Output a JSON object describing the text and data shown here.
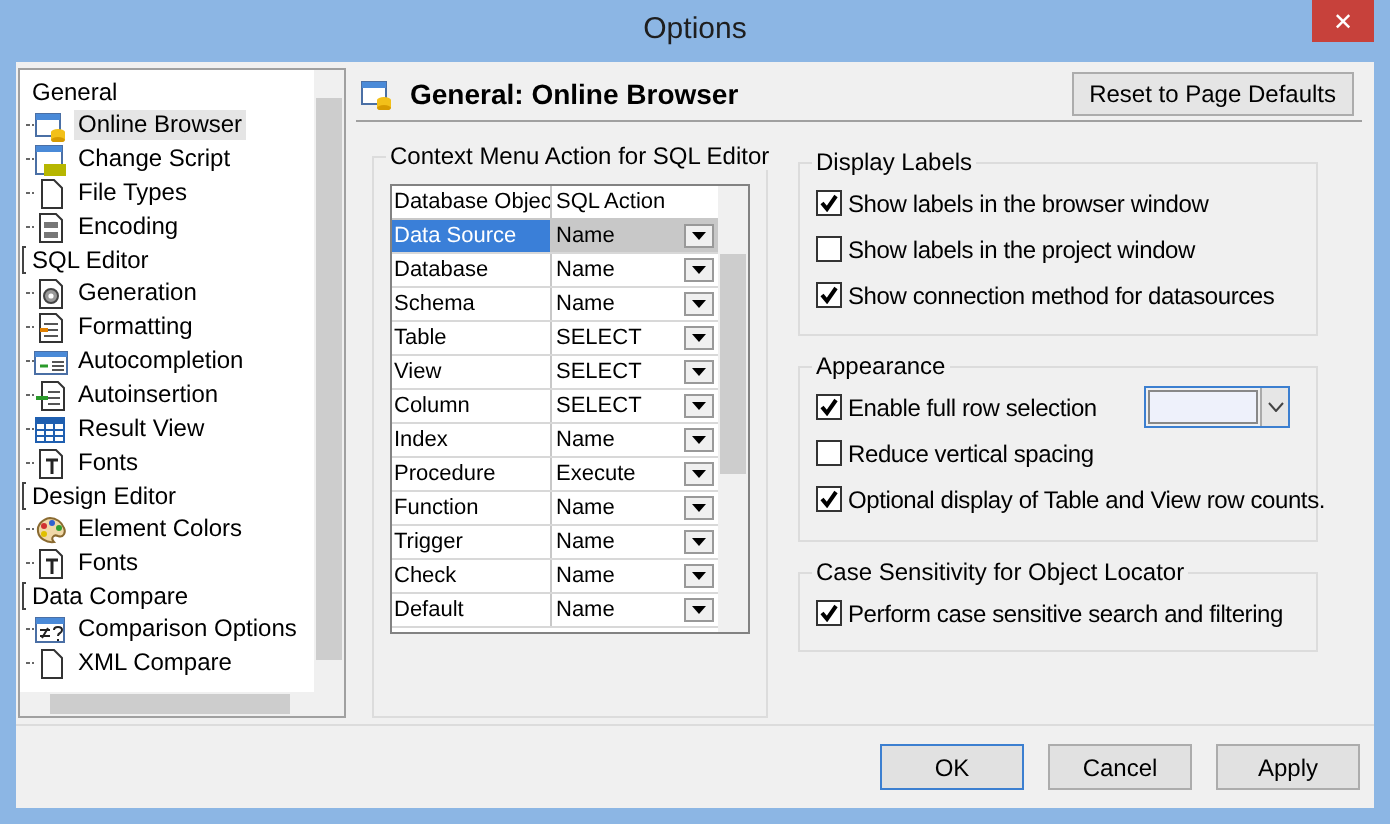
{
  "window": {
    "title": "Options",
    "close": "✕"
  },
  "sidebar": {
    "groups": [
      {
        "label": "General",
        "items": [
          {
            "label": "Online Browser",
            "kind": "browser",
            "selected": true
          },
          {
            "label": "Change Script",
            "kind": "sql",
            "selected": false
          },
          {
            "label": "File Types",
            "kind": "file",
            "selected": false
          },
          {
            "label": "Encoding",
            "kind": "encoding",
            "selected": false
          }
        ]
      },
      {
        "label": "SQL Editor",
        "items": [
          {
            "label": "Generation",
            "kind": "gear",
            "selected": false
          },
          {
            "label": "Formatting",
            "kind": "format",
            "selected": false
          },
          {
            "label": "Autocompletion",
            "kind": "list",
            "selected": false
          },
          {
            "label": "Autoinsertion",
            "kind": "insert",
            "selected": false
          },
          {
            "label": "Result View",
            "kind": "grid",
            "selected": false
          },
          {
            "label": "Fonts",
            "kind": "font",
            "selected": false
          }
        ]
      },
      {
        "label": "Design Editor",
        "items": [
          {
            "label": "Element Colors",
            "kind": "palette",
            "selected": false
          },
          {
            "label": "Fonts",
            "kind": "font",
            "selected": false
          }
        ]
      },
      {
        "label": "Data Compare",
        "items": [
          {
            "label": "Comparison Options",
            "kind": "compare",
            "selected": false
          },
          {
            "label": "XML Compare",
            "kind": "file",
            "selected": false
          }
        ]
      }
    ]
  },
  "page": {
    "title": "General: Online Browser",
    "reset_button": "Reset to Page Defaults"
  },
  "context_menu": {
    "title": "Context Menu Action for SQL Editor",
    "columns": [
      "Database Objec",
      "SQL Action"
    ],
    "rows": [
      {
        "object": "Data Source",
        "action": "Name",
        "selected": true
      },
      {
        "object": "Database",
        "action": "Name",
        "selected": false
      },
      {
        "object": "Schema",
        "action": "Name",
        "selected": false
      },
      {
        "object": "Table",
        "action": "SELECT",
        "selected": false
      },
      {
        "object": "View",
        "action": "SELECT",
        "selected": false
      },
      {
        "object": "Column",
        "action": "SELECT",
        "selected": false
      },
      {
        "object": "Index",
        "action": "Name",
        "selected": false
      },
      {
        "object": "Procedure",
        "action": "Execute",
        "selected": false
      },
      {
        "object": "Function",
        "action": "Name",
        "selected": false
      },
      {
        "object": "Trigger",
        "action": "Name",
        "selected": false
      },
      {
        "object": "Check",
        "action": "Name",
        "selected": false
      },
      {
        "object": "Default",
        "action": "Name",
        "selected": false
      }
    ]
  },
  "groups": [
    {
      "title": "Display Labels",
      "options": [
        {
          "label": "Show labels in the browser window",
          "checked": true
        },
        {
          "label": "Show labels in the project window",
          "checked": false
        },
        {
          "label": "Show connection method for datasources",
          "checked": true
        }
      ]
    },
    {
      "title": "Appearance",
      "options": [
        {
          "label": "Enable full row selection",
          "checked": true,
          "color": "#eef1fb"
        },
        {
          "label": "Reduce vertical spacing",
          "checked": false
        },
        {
          "label": "Optional display of Table and View row counts.",
          "checked": true
        }
      ]
    },
    {
      "title": "Case Sensitivity for Object Locator",
      "options": [
        {
          "label": "Perform case sensitive search and filtering",
          "checked": true
        }
      ]
    }
  ],
  "buttons": [
    {
      "label": "OK",
      "selected": true
    },
    {
      "label": "Cancel",
      "selected": false
    },
    {
      "label": "Apply",
      "selected": false
    }
  ]
}
